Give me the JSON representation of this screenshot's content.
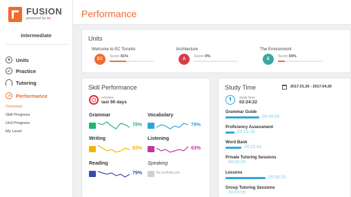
{
  "logo": {
    "name": "FUSION",
    "tagline": "powered by"
  },
  "level": "Intermediate",
  "nav": [
    {
      "label": "Units",
      "icon": "units-icon"
    },
    {
      "label": "Practice",
      "icon": "practice-icon"
    },
    {
      "label": "Tutoring",
      "icon": "headset-icon"
    },
    {
      "label": "Performance",
      "icon": "performance-icon"
    }
  ],
  "subnav": [
    "Overview",
    "Skill Progress",
    "Unit Progress",
    "My Level"
  ],
  "page_title": "Performance",
  "units_card": {
    "title": "Units",
    "items": [
      {
        "name": "Welcome to EC Toronto",
        "score_label": "Score",
        "score": "81%",
        "progress": 0.38,
        "color": "#f26a2e",
        "badge": "EC"
      },
      {
        "name": "Architecture",
        "score_label": "Score",
        "score": "0%",
        "progress": 0,
        "color": "#d93b4a",
        "badge": "A"
      },
      {
        "name": "The Environment",
        "score_label": "Score",
        "score": "69%",
        "progress": 0.15,
        "color": "#3ba7a0",
        "badge": "E"
      }
    ]
  },
  "skill_card": {
    "title": "Skill Performance",
    "activities_label": "Activities",
    "activities_value": "last 90 days",
    "skills": [
      {
        "name": "Grammar",
        "pct": "78%",
        "color": "#22b573",
        "points": [
          6,
          5,
          7,
          4,
          2,
          6,
          5,
          3
        ]
      },
      {
        "name": "Vocabulary",
        "pct": "79%",
        "color": "#2aa8dc",
        "points": [
          3,
          5,
          4,
          2,
          4,
          3,
          6,
          5
        ]
      },
      {
        "name": "Writing",
        "pct": "83%",
        "color": "#f5b400",
        "points": [
          7,
          5,
          3,
          4,
          2,
          3,
          5,
          4
        ]
      },
      {
        "name": "Listening",
        "pct": "63%",
        "color": "#c2389a",
        "points": [
          5,
          3,
          4,
          2,
          3,
          4,
          3,
          6
        ]
      },
      {
        "name": "Reading",
        "pct": "79%",
        "color": "#3b4cad",
        "points": [
          6,
          5,
          4,
          5,
          3,
          4,
          2,
          4
        ]
      },
      {
        "name": "Speaking",
        "empty": "No activity yet",
        "color": "#888888"
      }
    ]
  },
  "study_card": {
    "title": "Study Time",
    "date_range": "2017.01.26 - 2017.04.26",
    "total_label": "Study Time",
    "total_value": "02:24:22",
    "activities": [
      {
        "name": "Grammar Guide",
        "time": "00:49:55",
        "fraction": 0.41
      },
      {
        "name": "Proficiency Assessment",
        "time": "00:13:19",
        "fraction": 0.11
      },
      {
        "name": "Word Bank",
        "time": "00:22:41",
        "fraction": 0.19
      },
      {
        "name": "Private Tutoring Sessions",
        "time": "00:00:00",
        "fraction": 0
      },
      {
        "name": "Lessons",
        "time": "00:58:23",
        "fraction": 0.48
      },
      {
        "name": "Group Tutoring Sessions",
        "time": "00:00:00",
        "fraction": 0
      }
    ]
  },
  "colors": {
    "accent": "#f26a2e",
    "study": "#2aa8dc"
  }
}
